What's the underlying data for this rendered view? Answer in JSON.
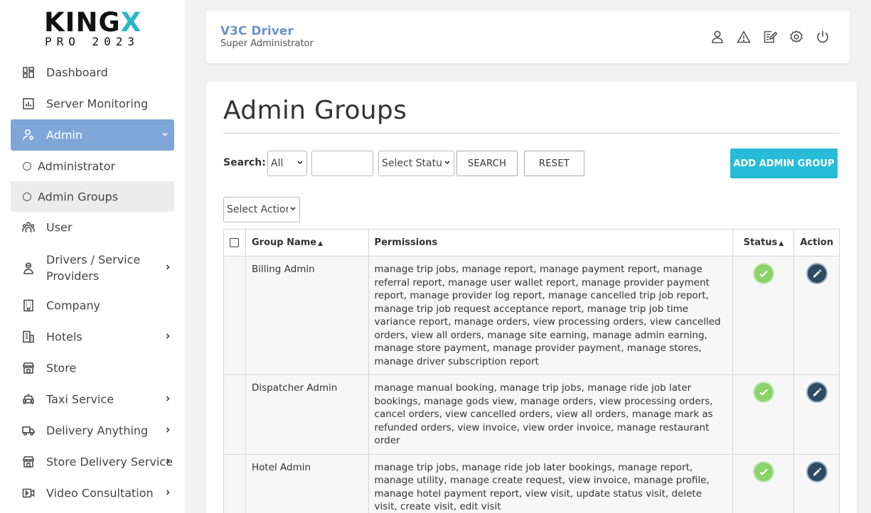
{
  "logo": {
    "main_a": "KING",
    "main_b": "X",
    "sub": "PRO 2023"
  },
  "sidebar": {
    "items": [
      {
        "label": "Dashboard",
        "icon": "dashboard-icon"
      },
      {
        "label": "Server Monitoring",
        "icon": "chart-icon"
      },
      {
        "label": "Admin",
        "icon": "admin-user-icon",
        "active": true,
        "expanded": true
      },
      {
        "label": "Administrator",
        "sub": true
      },
      {
        "label": "Admin Groups",
        "sub": true,
        "selected": true
      },
      {
        "label": "User",
        "icon": "users-icon"
      },
      {
        "label": "Drivers / Service Providers",
        "icon": "driver-icon",
        "has_children": true
      },
      {
        "label": "Company",
        "icon": "building-icon"
      },
      {
        "label": "Hotels",
        "icon": "hotel-icon",
        "has_children": true
      },
      {
        "label": "Store",
        "icon": "store-icon"
      },
      {
        "label": "Taxi Service",
        "icon": "taxi-icon",
        "has_children": true
      },
      {
        "label": "Delivery Anything",
        "icon": "truck-icon",
        "has_children": true
      },
      {
        "label": "Store Delivery Service",
        "icon": "store-icon",
        "has_children": true
      },
      {
        "label": "Video Consultation",
        "icon": "video-icon",
        "has_children": true
      }
    ]
  },
  "header": {
    "user_name": "V3C Driver",
    "user_role": "Super Administrator",
    "icons": [
      "profile-icon",
      "alert-icon",
      "edit-note-icon",
      "settings-icon",
      "power-icon"
    ]
  },
  "main": {
    "title": "Admin Groups",
    "search_label": "Search:",
    "search_field_value": "All",
    "search_input_value": "",
    "status_select_value": "Select Statu",
    "search_button": "SEARCH",
    "reset_button": "RESET",
    "add_button": "ADD ADMIN GROUP",
    "action_select_value": "Select Actior"
  },
  "table": {
    "headers": {
      "group_name": "Group Name",
      "permissions": "Permissions",
      "status": "Status",
      "action": "Action"
    },
    "rows": [
      {
        "group_name": "Billing Admin",
        "permissions": "manage trip jobs, manage report, manage payment report, manage referral report, manage user wallet report, manage provider payment report, manage provider log report, manage cancelled trip job report, manage trip job request acceptance report, manage trip job time variance report, manage orders, view processing orders, view cancelled orders, view all orders, manage site earning, manage admin earning, manage store payment, manage provider payment, manage stores, manage driver subscription report",
        "status": "active"
      },
      {
        "group_name": "Dispatcher Admin",
        "permissions": "manage manual booking, manage trip jobs, manage ride job later bookings, manage gods view, manage orders, view processing orders, cancel orders, view cancelled orders, view all orders, manage mark as refunded orders, view invoice, view order invoice, manage restaurant order",
        "status": "active"
      },
      {
        "group_name": "Hotel Admin",
        "permissions": "manage trip jobs, manage ride job later bookings, manage report, manage utility, manage create request, view invoice, manage profile, manage hotel payment report, view visit, update status visit, delete visit, create visit, edit visit",
        "status": "active"
      }
    ]
  },
  "colors": {
    "accent": "#26bcd6",
    "sidebar_active": "#7ea6d6",
    "user_name": "#6a93c9",
    "status_ok": "#8bd36b",
    "edit_btn": "#2f4a63"
  }
}
